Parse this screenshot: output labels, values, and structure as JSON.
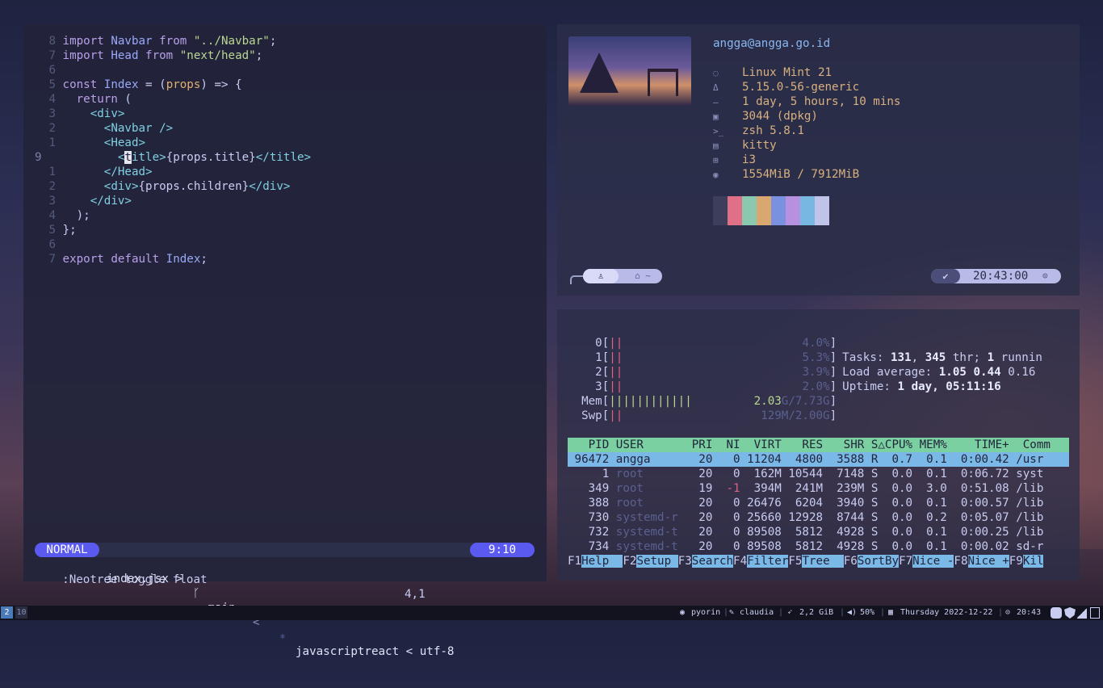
{
  "editor": {
    "lines": [
      {
        "num": "8",
        "segments": [
          [
            "kw",
            "import "
          ],
          [
            "var",
            "Navbar"
          ],
          [
            "kw",
            " from "
          ],
          [
            "str",
            "\"../Navbar\""
          ],
          [
            "code",
            ";"
          ]
        ]
      },
      {
        "num": "7",
        "segments": [
          [
            "kw",
            "import "
          ],
          [
            "var",
            "Head"
          ],
          [
            "kw",
            " from "
          ],
          [
            "str",
            "\"next/head\""
          ],
          [
            "code",
            ";"
          ]
        ]
      },
      {
        "num": "6",
        "segments": []
      },
      {
        "num": "5",
        "segments": [
          [
            "kw",
            "const "
          ],
          [
            "var",
            "Index"
          ],
          [
            "code",
            " = ("
          ],
          [
            "pn",
            "props"
          ],
          [
            "code",
            ") => {"
          ]
        ]
      },
      {
        "num": "4",
        "segments": [
          [
            "kw",
            "  return "
          ],
          [
            "code",
            "("
          ]
        ]
      },
      {
        "num": "3",
        "segments": [
          [
            "tag",
            "    <div>"
          ]
        ]
      },
      {
        "num": "2",
        "segments": [
          [
            "tag",
            "      <Navbar />"
          ]
        ]
      },
      {
        "num": "1",
        "segments": [
          [
            "tag",
            "      <Head>"
          ]
        ]
      },
      {
        "num": "9",
        "current": true,
        "segments": [
          [
            "tag",
            "        <"
          ],
          [
            "cursor",
            "t"
          ],
          [
            "tag",
            "itle>"
          ],
          [
            "code",
            "{props.title}"
          ],
          [
            "tag",
            "</title>"
          ]
        ]
      },
      {
        "num": "1",
        "segments": [
          [
            "tag",
            "      </Head>"
          ]
        ]
      },
      {
        "num": "2",
        "segments": [
          [
            "tag",
            "      <div>"
          ],
          [
            "code",
            "{props.children}"
          ],
          [
            "tag",
            "</div>"
          ]
        ]
      },
      {
        "num": "3",
        "segments": [
          [
            "tag",
            "    </div>"
          ]
        ]
      },
      {
        "num": "4",
        "segments": [
          [
            "code",
            "  );"
          ]
        ]
      },
      {
        "num": "5",
        "segments": [
          [
            "code",
            "};"
          ]
        ]
      },
      {
        "num": "6",
        "segments": []
      },
      {
        "num": "7",
        "segments": [
          [
            "kw",
            "export default "
          ],
          [
            "var",
            "Index"
          ],
          [
            "code",
            ";"
          ]
        ]
      }
    ],
    "status": {
      "mode": "NORMAL",
      "file": "index.jsx >",
      "branch_icon": "git-branch-icon",
      "branch": " main",
      "sep": "<",
      "filetype_icon": "react-icon",
      "filetype": "javascriptreact < utf-8",
      "position": "9:10"
    },
    "cmdline": ":Neotree toggle float",
    "cursor_pos": "4,1"
  },
  "fetch": {
    "user_host": "angga@angga.go.id",
    "rows": [
      {
        "icon": "◌",
        "value": "Linux Mint 21"
      },
      {
        "icon": "Δ",
        "value": "5.15.0-56-generic"
      },
      {
        "icon": "—",
        "value": "1 day, 5 hours, 10 mins"
      },
      {
        "icon": "▣",
        "value": "3044 (dpkg)"
      },
      {
        "icon": ">_",
        "value": "zsh 5.8.1"
      },
      {
        "icon": "▤",
        "value": "kitty"
      },
      {
        "icon": "⊞",
        "value": "i3"
      },
      {
        "icon": "◉",
        "value": "1554MiB / 7912MiB"
      }
    ],
    "swatches": [
      "#3c3e5c",
      "#e07088",
      "#8ac8b0",
      "#d8a870",
      "#7a90e0",
      "#b890e0",
      "#78b8e0",
      "#c0c4e8"
    ],
    "prompt_left_icon": "tux-icon",
    "prompt_left_path": "⌂ ~",
    "prompt_check": "✔",
    "prompt_time": "20:43:00",
    "prompt_clock": "⊙"
  },
  "htop": {
    "cpus": [
      {
        "label": "    0[",
        "bars": "||",
        "pct": "4.0%]"
      },
      {
        "label": "    1[",
        "bars": "||",
        "pct": "5.3%]"
      },
      {
        "label": "    2[",
        "bars": "||",
        "pct": "3.9%]"
      },
      {
        "label": "    3[",
        "bars": "||",
        "pct": "2.0%]"
      }
    ],
    "mem": {
      "label": "  Mem[",
      "bars": "||||||||||||",
      "val": "2.03",
      "rest": "G/7.73G]"
    },
    "swp": {
      "label": "  Swp[",
      "bars": "||",
      "rest": "129M/2.00G]"
    },
    "tasks": {
      "pre": "Tasks: ",
      "a": "131",
      "mid": ", ",
      "b": "345",
      "mid2": " thr; ",
      "c": "1",
      "post": " runnin"
    },
    "load": {
      "pre": "Load average: ",
      "a": "1.05",
      "sp": " ",
      "b": "0.44",
      "c": " 0.16"
    },
    "uptime": {
      "pre": "Uptime: ",
      "val": "1 day, 05:11:16"
    },
    "header": "   PID USER       PRI  NI  VIRT   RES   SHR S△CPU% MEM%    TIME+  Comm",
    "rows": [
      {
        "pid": " 96472",
        "user": " angga     ",
        "rest": "  20   0 11204  4800  3588 R  0.7  0.1  0:00.42 /usr",
        "selected": true
      },
      {
        "pid": "     1",
        "user": " root      ",
        "rest": "  20   0  162M 10544  7148 S  0.0  0.1  0:06.72 syst"
      },
      {
        "pid": "   349",
        "user": " root      ",
        "rest_a": "  19  ",
        "ni": "-1",
        "rest": "  394M  241M  239M S  0.0  3.0  0:51.08 /lib"
      },
      {
        "pid": "   388",
        "user": " root      ",
        "rest": "  20   0 26476  6204  3940 S  0.0  0.1  0:00.57 /lib"
      },
      {
        "pid": "   730",
        "user": " systemd-r ",
        "rest": "  20   0 25660 12928  8744 S  0.0  0.2  0:05.07 /lib"
      },
      {
        "pid": "   732",
        "user": " systemd-t ",
        "rest": "  20   0 89508  5812  4928 S  0.0  0.1  0:00.25 /lib"
      },
      {
        "pid": "   734",
        "user": " systemd-t ",
        "rest": "  20   0 89508  5812  4928 S  0.0  0.1  0:00.02 sd-r"
      }
    ],
    "fkeys": [
      {
        "k": "F1",
        "l": "Help  "
      },
      {
        "k": "F2",
        "l": "Setup "
      },
      {
        "k": "F3",
        "l": "Search"
      },
      {
        "k": "F4",
        "l": "Filter"
      },
      {
        "k": "F5",
        "l": "Tree  "
      },
      {
        "k": "F6",
        "l": "SortBy"
      },
      {
        "k": "F7",
        "l": "Nice -"
      },
      {
        "k": "F8",
        "l": "Nice +"
      },
      {
        "k": "F9",
        "l": "Kil"
      }
    ]
  },
  "bar": {
    "ws_active": "2",
    "ws_other": "10",
    "github_icon": "github-icon",
    "github": "pyorin",
    "host_icon": "pen-icon",
    "host": "claudia",
    "mem_icon": "rocket-icon",
    "mem": "2,2 GiB",
    "vol_icon": "speaker-icon",
    "vol": "50%",
    "date_icon": "calendar-icon",
    "date": "Thursday 2022-12-22",
    "time_icon": "clock-icon",
    "time": "20:43"
  }
}
